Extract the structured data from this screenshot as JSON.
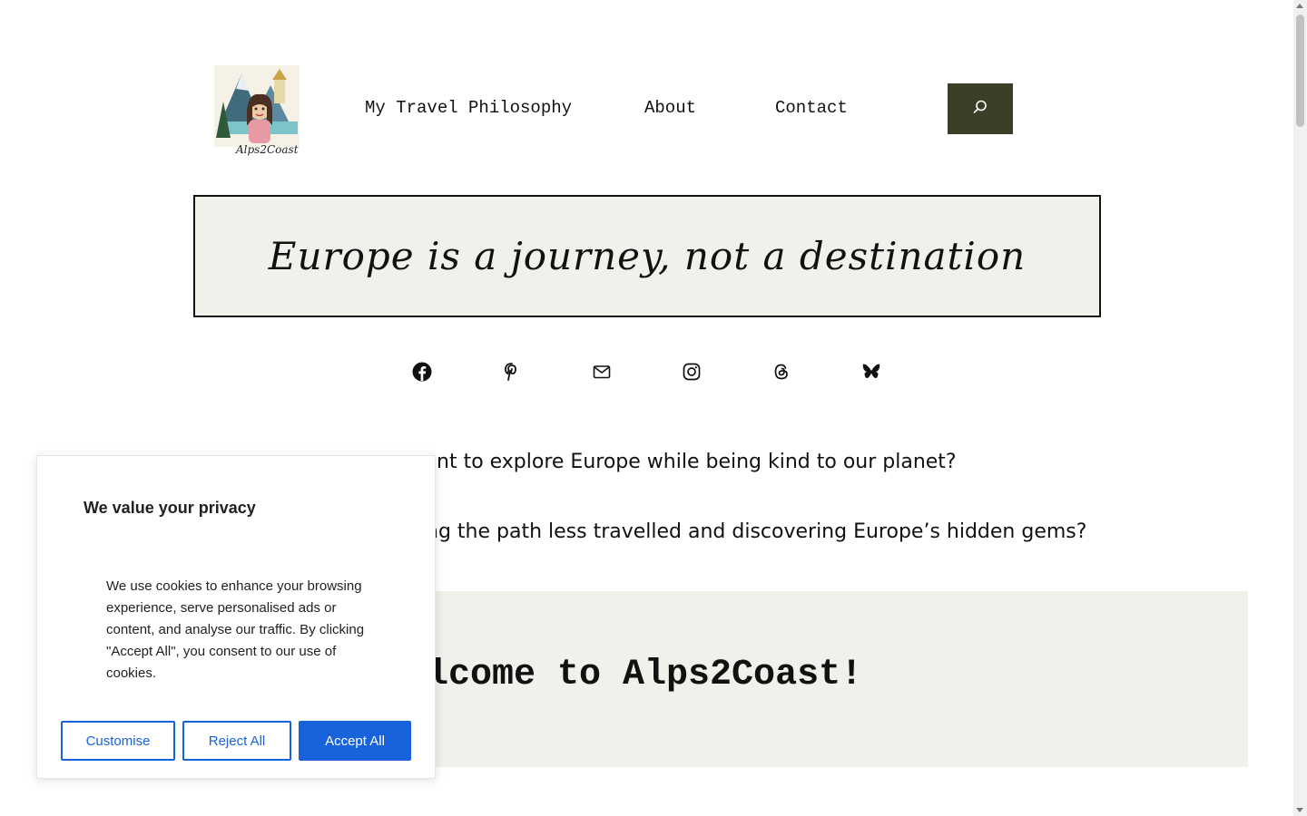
{
  "header": {
    "logo_text": "Alps2Coast",
    "nav": [
      {
        "label": "My Travel Philosophy"
      },
      {
        "label": "About"
      },
      {
        "label": "Contact"
      }
    ],
    "search_icon": "search-icon",
    "search_bg": "#3b3f28"
  },
  "tagline": "Europe is a journey, not a destination",
  "social": [
    {
      "icon": "facebook-icon"
    },
    {
      "icon": "pinterest-icon"
    },
    {
      "icon": "mail-icon"
    },
    {
      "icon": "instagram-icon"
    },
    {
      "icon": "threads-icon"
    },
    {
      "icon": "bluesky-icon"
    }
  ],
  "intro": {
    "line1": "nt to explore Europe while being kind to our planet?",
    "line2": "ng the path less travelled and discovering Europe’s hidden gems?"
  },
  "welcome_heading": "lcome to Alps2Coast!",
  "cookie": {
    "title": "We value your privacy",
    "text": "We use cookies to enhance your browsing experience, serve personalised ads or content, and analyse our traffic. By clicking \"Accept All\", you consent to our use of cookies.",
    "customise": "Customise",
    "reject": "Reject All",
    "accept": "Accept All",
    "accent": "#1863dc"
  }
}
